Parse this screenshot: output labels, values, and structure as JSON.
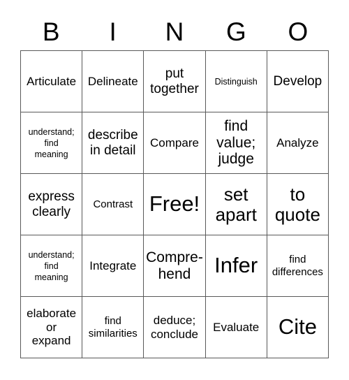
{
  "card": {
    "header_letters": [
      "B",
      "I",
      "N",
      "G",
      "O"
    ],
    "colors": {
      "background": "#ffffff",
      "text": "#000000",
      "grid_line": "#595959"
    },
    "grid": {
      "columns": 5,
      "rows": 5,
      "free_space": {
        "row": 3,
        "column": 3,
        "label": "Free!"
      }
    },
    "cells": [
      [
        {
          "text": "Articulate",
          "size": "m"
        },
        {
          "text": "Delineate",
          "size": "m"
        },
        {
          "text": "put\ntogether",
          "size": "ml"
        },
        {
          "text": "Distinguish",
          "size": "xs"
        },
        {
          "text": "Develop",
          "size": "ml"
        }
      ],
      [
        {
          "text": "understand;\nfind\nmeaning",
          "size": "xs"
        },
        {
          "text": "describe\nin detail",
          "size": "ml"
        },
        {
          "text": "Compare",
          "size": "m"
        },
        {
          "text": "find\nvalue;\njudge",
          "size": "l"
        },
        {
          "text": "Analyze",
          "size": "m"
        }
      ],
      [
        {
          "text": "express\nclearly",
          "size": "ml"
        },
        {
          "text": "Contrast",
          "size": "s"
        },
        {
          "text": "Free!",
          "size": "xxl"
        },
        {
          "text": "set\napart",
          "size": "xl"
        },
        {
          "text": "to\nquote",
          "size": "xl"
        }
      ],
      [
        {
          "text": "understand;\nfind\nmeaning",
          "size": "xs"
        },
        {
          "text": "Integrate",
          "size": "m"
        },
        {
          "text": "Compre-\nhend",
          "size": "l"
        },
        {
          "text": "Infer",
          "size": "xxl"
        },
        {
          "text": "find\ndifferences",
          "size": "s"
        }
      ],
      [
        {
          "text": "elaborate\nor\nexpand",
          "size": "m"
        },
        {
          "text": "find\nsimilarities",
          "size": "s"
        },
        {
          "text": "deduce;\nconclude",
          "size": "m"
        },
        {
          "text": "Evaluate",
          "size": "m"
        },
        {
          "text": "Cite",
          "size": "xxl"
        }
      ]
    ]
  }
}
